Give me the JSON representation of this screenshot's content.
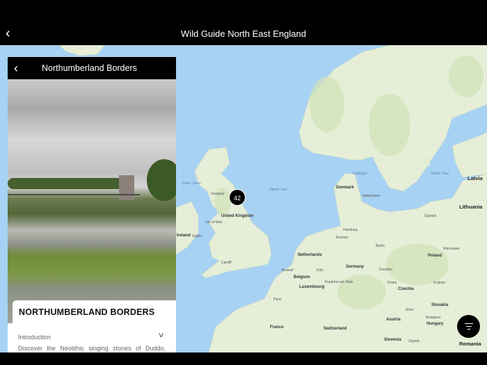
{
  "header": {
    "title": "Wild Guide North East England",
    "back_icon": "chevron-left"
  },
  "panel": {
    "title": "Northumberland Borders",
    "card_title": "NORTHUMBERLAND BORDERS",
    "section_label": "Introduction",
    "description": "Discover the Neolithic singing stones of Duddo,"
  },
  "map": {
    "cluster_count": "42",
    "labels": [
      "North Sea",
      "Baltic Sea",
      "Kattegat",
      "Inner Seas",
      "United Kingdom",
      "Isle of Man",
      "Dublin",
      "Ireland",
      "Glasgow",
      "Cardiff",
      "Denmark",
      "København",
      "Hamburg",
      "Bremen",
      "Berlin",
      "Germany",
      "Netherlands",
      "Brussel",
      "Belgium",
      "Luxembourg",
      "Köln",
      "Frankfurt am Main",
      "Poland",
      "Warszawa",
      "Gdańsk",
      "Lithuania",
      "Latvia",
      "Czechia",
      "Praha",
      "Slovakia",
      "Wien",
      "Austria",
      "Budapest",
      "Hungary",
      "Switzerland",
      "France",
      "Slovenia",
      "Zagreb",
      "Romania",
      "Paris",
      "Kraków",
      "Dresden"
    ]
  },
  "colors": {
    "sea": "#a8d2f3",
    "land": "#e8f0dc",
    "bar": "#000000"
  }
}
